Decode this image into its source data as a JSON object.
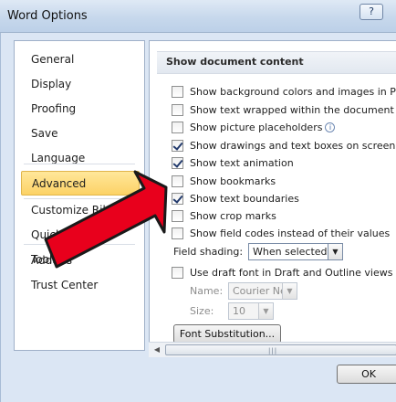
{
  "window": {
    "title": "Word Options",
    "help_button": "?"
  },
  "nav": {
    "items": [
      {
        "label": "General"
      },
      {
        "label": "Display"
      },
      {
        "label": "Proofing"
      },
      {
        "label": "Save"
      },
      {
        "label": "Language"
      },
      {
        "label": "Advanced"
      },
      {
        "label": "Customize Ribbon"
      },
      {
        "label": "Quick Access Toolbar"
      },
      {
        "label": "Add-Ins"
      },
      {
        "label": "Trust Center"
      }
    ],
    "selected": "Advanced"
  },
  "section": {
    "title": "Show document content"
  },
  "options": [
    {
      "label": "Show background colors and images in Print Layout view",
      "checked": false
    },
    {
      "label": "Show text wrapped within the document window",
      "checked": false
    },
    {
      "label": "Show picture placeholders",
      "checked": false,
      "info_icon": "info-icon"
    },
    {
      "label": "Show drawings and text boxes on screen",
      "checked": true
    },
    {
      "label": "Show text animation",
      "checked": true
    },
    {
      "label": "Show bookmarks",
      "checked": false
    },
    {
      "label": "Show text boundaries",
      "checked": true
    },
    {
      "label": "Show crop marks",
      "checked": false
    },
    {
      "label": "Show field codes instead of their values",
      "checked": false
    }
  ],
  "field_shading": {
    "label": "Field shading:",
    "value": "When selected"
  },
  "draft_font": {
    "label": "Use draft font in Draft and Outline views",
    "checked": false
  },
  "font_name": {
    "label": "Name:",
    "value": "Courier New",
    "disabled": true
  },
  "font_size": {
    "label": "Size:",
    "value": "10",
    "disabled": true
  },
  "font_substitution_button": "Font Substitution...",
  "ok_button": "OK",
  "annotation": {
    "color": "#e8001c",
    "icon": "red-pointer-arrow"
  }
}
